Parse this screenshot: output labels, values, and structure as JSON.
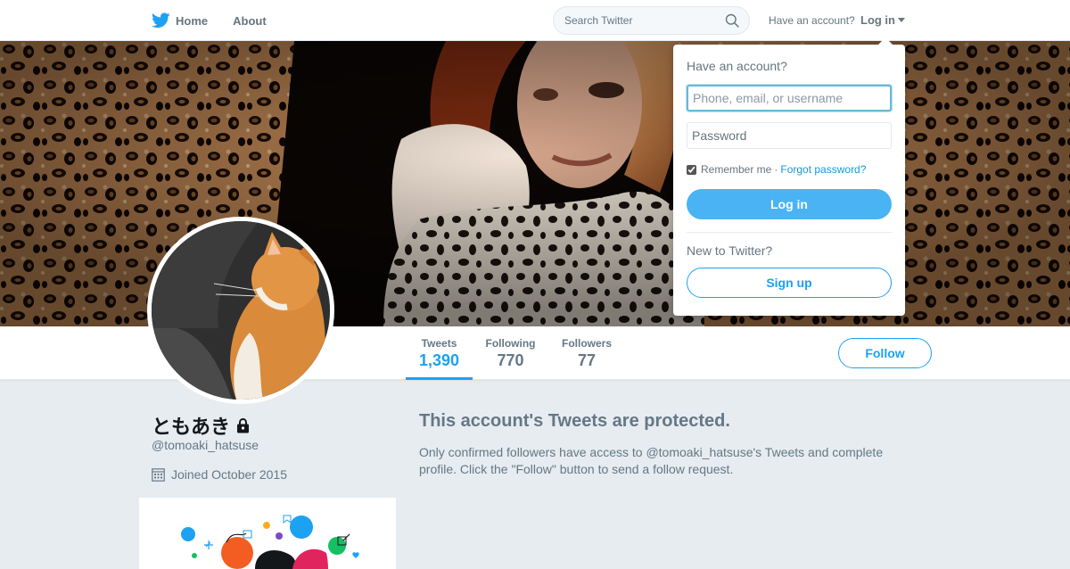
{
  "nav": {
    "home_label": "Home",
    "about_label": "About",
    "search_placeholder": "Search Twitter",
    "account_prompt": "Have an account?",
    "login_label": "Log in"
  },
  "profile": {
    "name": "ともあき",
    "handle": "@tomoaki_hatsuse",
    "joined": "Joined October 2015",
    "follow_label": "Follow"
  },
  "stats": [
    {
      "label": "Tweets",
      "value": "1,390",
      "active": true
    },
    {
      "label": "Following",
      "value": "770",
      "active": false
    },
    {
      "label": "Followers",
      "value": "77",
      "active": false
    }
  ],
  "protected": {
    "title": "This account's Tweets are protected.",
    "body": "Only confirmed followers have access to @tomoaki_hatsuse's Tweets and complete profile. Click the \"Follow\" button to send a follow request."
  },
  "login_dropdown": {
    "heading": "Have an account?",
    "username_placeholder": "Phone, email, or username",
    "password_placeholder": "Password",
    "remember_label": "Remember me",
    "separator": "·",
    "forgot_label": "Forgot password?",
    "login_button": "Log in",
    "new_prompt": "New to Twitter?",
    "signup_button": "Sign up"
  },
  "colors": {
    "brand": "#1da1f2",
    "login_button": "#4ab3f4",
    "muted_text": "#657786",
    "page_background": "#e6ecf0"
  },
  "icons": [
    "twitter-bird-icon",
    "search-icon",
    "caret-down-icon",
    "lock-icon",
    "calendar-icon"
  ]
}
